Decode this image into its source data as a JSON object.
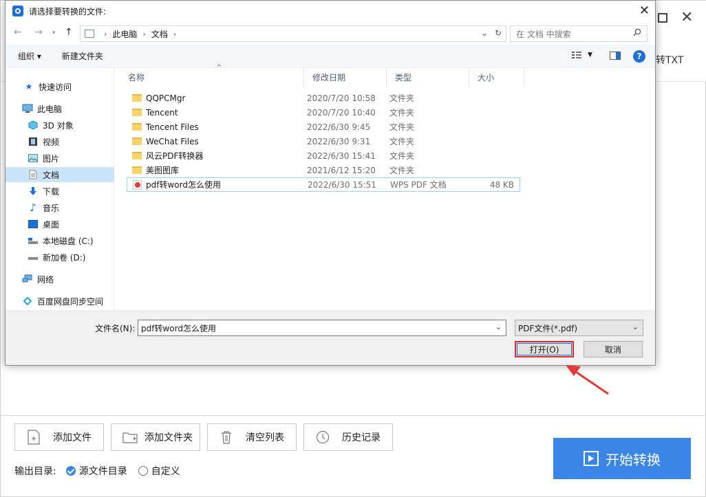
{
  "app": {
    "toolbar_right_text": "转TXT",
    "tool_buttons": [
      {
        "label": "添加文件"
      },
      {
        "label": "添加文件夹"
      },
      {
        "label": "清空列表"
      },
      {
        "label": "历史记录"
      }
    ],
    "start_label": "开始转换",
    "output_label": "输出目录:",
    "output_options": [
      {
        "label": "源文件目录",
        "selected": true
      },
      {
        "label": "自定义",
        "selected": false
      }
    ]
  },
  "dialog": {
    "title": "请选择要转换的文件:",
    "breadcrumb": [
      "此电脑",
      "文档"
    ],
    "search_placeholder": "在 文档 中搜索",
    "organize_label": "组织 ▾",
    "new_folder_label": "新建文件夹",
    "sidebar": [
      {
        "label": "快速访问",
        "icon": "star-icon"
      },
      {
        "label": "此电脑",
        "icon": "computer-icon"
      },
      {
        "label": "3D 对象",
        "icon": "cube-icon"
      },
      {
        "label": "视频",
        "icon": "film-icon"
      },
      {
        "label": "图片",
        "icon": "picture-icon"
      },
      {
        "label": "文档",
        "icon": "document-icon",
        "selected": true
      },
      {
        "label": "下载",
        "icon": "download-icon"
      },
      {
        "label": "音乐",
        "icon": "music-icon"
      },
      {
        "label": "桌面",
        "icon": "desktop-icon"
      },
      {
        "label": "本地磁盘 (C:)",
        "icon": "drive-icon"
      },
      {
        "label": "新加卷 (D:)",
        "icon": "drive-icon"
      },
      {
        "label": "网络",
        "icon": "network-icon"
      },
      {
        "label": "百度网盘同步空间",
        "icon": "baidu-cloud-icon"
      }
    ],
    "columns": {
      "name": "名称",
      "date": "修改日期",
      "type": "类型",
      "size": "大小"
    },
    "files": [
      {
        "name": "QQPCMgr",
        "date": "2020/7/20 10:58",
        "type": "文件夹",
        "size": "",
        "kind": "folder"
      },
      {
        "name": "Tencent",
        "date": "2020/7/20 10:40",
        "type": "文件夹",
        "size": "",
        "kind": "folder"
      },
      {
        "name": "Tencent Files",
        "date": "2022/6/30 9:45",
        "type": "文件夹",
        "size": "",
        "kind": "folder"
      },
      {
        "name": "WeChat Files",
        "date": "2022/6/30 9:31",
        "type": "文件夹",
        "size": "",
        "kind": "folder"
      },
      {
        "name": "风云PDF转换器",
        "date": "2022/6/30 15:41",
        "type": "文件夹",
        "size": "",
        "kind": "folder"
      },
      {
        "name": "美图图库",
        "date": "2021/6/12 15:20",
        "type": "文件夹",
        "size": "",
        "kind": "folder"
      },
      {
        "name": "pdf转word怎么使用",
        "date": "2022/6/30 15:51",
        "type": "WPS PDF 文档",
        "size": "48 KB",
        "kind": "pdf",
        "selected": true
      }
    ],
    "filename_label": "文件名(N):",
    "filename_value": "pdf转word怎么使用",
    "filetype_value": "PDF文件(*.pdf)",
    "open_label": "打开(O)",
    "cancel_label": "取消"
  }
}
